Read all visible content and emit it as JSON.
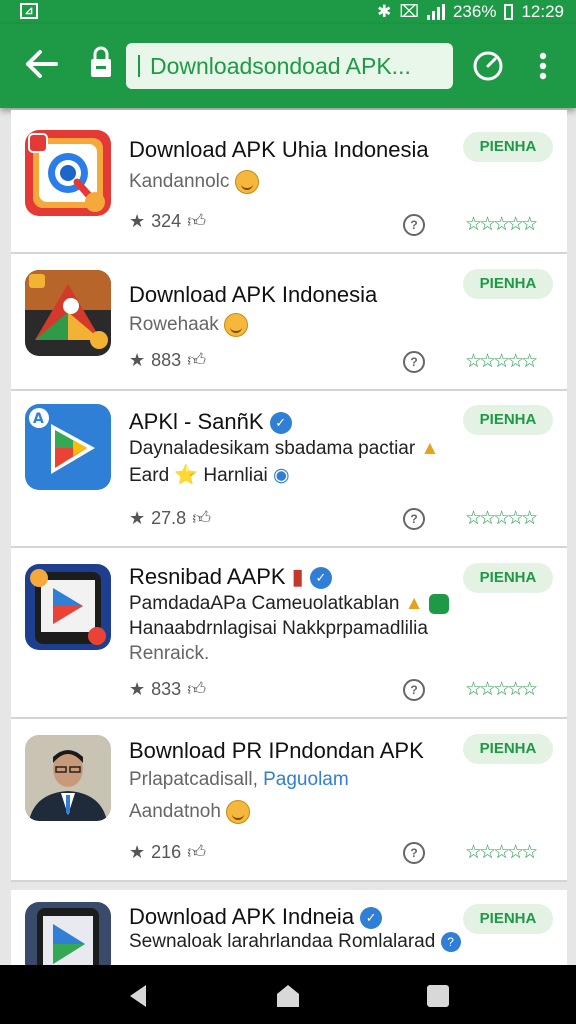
{
  "status": {
    "carrier_icon": "app-logo",
    "battery": "236%",
    "time": "12:29"
  },
  "toolbar": {
    "url": "Downloadsondoad APK..."
  },
  "cards": [
    {
      "title": "Download APK Uhia Indonesia",
      "line1": "Kandannolc",
      "line2": "",
      "line3": "",
      "badge": "PIENHA",
      "rating_count": "324",
      "stars": "☆☆☆☆☆"
    },
    {
      "title": "Download APK Indonesia",
      "line1": "Rowehaak",
      "line2": "",
      "line3": "",
      "badge": "PIENHA",
      "rating_count": "883",
      "stars": "☆☆☆☆☆"
    },
    {
      "title": "APKl - SanñK",
      "line1": "Daynaladesikam sbadama pactiar",
      "line2": "Eard ⭐ Harnliai",
      "line3": "",
      "badge": "PIENHA",
      "rating_count": "27.8",
      "stars": "☆☆☆☆☆"
    },
    {
      "title": "Resnibad AAPK",
      "line1": "PamdadaAPa Cameuolatkablan",
      "line2": "Hanaabdrnlagisai  Nakkprpamadlilia",
      "line3": "Renraick.",
      "badge": "PIENHA",
      "rating_count": "833",
      "stars": "☆☆☆☆☆"
    },
    {
      "title": "Bownload PR IPndondan APK",
      "line1": "Prlapatcadisall,",
      "line1b": "Paguolam",
      "line2": "Aandatnoh",
      "line3": "",
      "badge": "PIENHA",
      "rating_count": "216",
      "stars": "☆☆☆☆☆"
    },
    {
      "title": "Download APK Indneia",
      "line1": "Sewnaloak larahrlandaa Romlalarad",
      "line2": "",
      "line3": "",
      "badge": "PIENHA",
      "rating_count": "",
      "stars": ""
    }
  ],
  "colors": {
    "brand": "#1e9a46",
    "badge_bg": "#e4f2e4"
  }
}
